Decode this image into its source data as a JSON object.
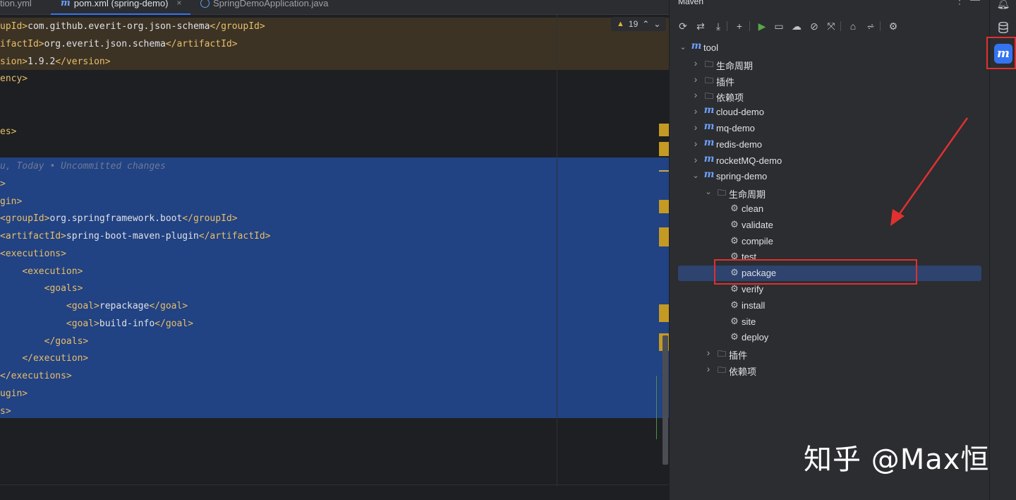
{
  "tabs": [
    {
      "label": "tion.yml",
      "icon": "yml-file-icon"
    },
    {
      "label": "pom.xml (spring-demo)",
      "icon": "maven-file-icon",
      "active": true,
      "close": "×"
    },
    {
      "label": "SpringDemoApplication.java",
      "icon": "java-class-icon"
    }
  ],
  "editor": {
    "warnings": {
      "count": "19",
      "up": "⌃",
      "down": "⌄"
    },
    "lines": [
      {
        "segs": [
          [
            "tag",
            "upId>"
          ],
          [
            "txt",
            "com.github.everit-org.json-schema"
          ],
          [
            "tag",
            "</groupId>"
          ]
        ]
      },
      {
        "segs": [
          [
            "tag",
            "ifactId>"
          ],
          [
            "txt",
            "org.everit.json.schema"
          ],
          [
            "tag",
            "</artifactId>"
          ]
        ]
      },
      {
        "segs": [
          [
            "tag",
            "sion>"
          ],
          [
            "txt",
            "1.9.2"
          ],
          [
            "tag",
            "</version>"
          ]
        ]
      },
      {
        "segs": [
          [
            "tag",
            "ency>"
          ]
        ]
      },
      {
        "segs": []
      },
      {
        "segs": []
      },
      {
        "segs": [
          [
            "tag",
            "es>"
          ]
        ]
      },
      {
        "segs": []
      },
      {
        "segs": [
          [
            "blame",
            "u, Today • Uncommitted changes"
          ]
        ]
      },
      {
        "segs": [
          [
            "tag",
            ">"
          ]
        ]
      },
      {
        "segs": [
          [
            "tag",
            "gin>"
          ]
        ]
      },
      {
        "segs": [
          [
            "tag",
            "<groupId>"
          ],
          [
            "txt",
            "org.springframework.boot"
          ],
          [
            "tag",
            "</groupId>"
          ]
        ]
      },
      {
        "segs": [
          [
            "tag",
            "<artifactId>"
          ],
          [
            "txt",
            "spring-boot-maven-plugin"
          ],
          [
            "tag",
            "</artifactId>"
          ]
        ]
      },
      {
        "segs": [
          [
            "tag",
            "<executions>"
          ]
        ]
      },
      {
        "segs": [
          [
            "txt",
            "    "
          ],
          [
            "tag",
            "<execution>"
          ]
        ]
      },
      {
        "segs": [
          [
            "txt",
            "        "
          ],
          [
            "tag",
            "<goals>"
          ]
        ]
      },
      {
        "segs": [
          [
            "txt",
            "            "
          ],
          [
            "tag",
            "<goal>"
          ],
          [
            "txt",
            "repackage"
          ],
          [
            "tag",
            "</goal>"
          ]
        ]
      },
      {
        "segs": [
          [
            "txt",
            "            "
          ],
          [
            "tag",
            "<goal>"
          ],
          [
            "txt",
            "build-info"
          ],
          [
            "tag",
            "</goal>"
          ]
        ]
      },
      {
        "segs": [
          [
            "txt",
            "        "
          ],
          [
            "tag",
            "</goals>"
          ]
        ]
      },
      {
        "segs": [
          [
            "txt",
            "    "
          ],
          [
            "tag",
            "</execution>"
          ]
        ]
      },
      {
        "segs": [
          [
            "tag",
            "</executions>"
          ]
        ]
      },
      {
        "segs": [
          [
            "tag",
            "ugin>"
          ]
        ]
      },
      {
        "segs": [
          [
            "tag",
            "s>"
          ]
        ]
      }
    ]
  },
  "maven": {
    "title": "Maven",
    "more": "⋮",
    "minimize": "—",
    "toolbar": [
      {
        "name": "reload-icon",
        "glyph": "⟳"
      },
      {
        "name": "generate-sources-icon",
        "glyph": "⇄"
      },
      {
        "name": "download-icon",
        "glyph": "⤓"
      },
      {
        "name": "add-icon",
        "glyph": "+"
      },
      {
        "name": "run-icon",
        "glyph": "▶"
      },
      {
        "name": "execute-goal-icon",
        "glyph": "▭"
      },
      {
        "name": "offline-mode-icon",
        "glyph": "☁"
      },
      {
        "name": "skip-tests-icon",
        "glyph": "⊘"
      },
      {
        "name": "collapse-icon",
        "glyph": "⤧"
      },
      {
        "name": "show-dependencies-icon",
        "glyph": "⌂"
      },
      {
        "name": "expand-all-icon",
        "glyph": "⩫"
      },
      {
        "name": "settings-icon",
        "glyph": "⚙"
      }
    ],
    "tree": [
      {
        "level": 0,
        "expanded": true,
        "icon": "m",
        "label": "tool"
      },
      {
        "level": 1,
        "expanded": false,
        "icon": "folder",
        "label": "生命周期"
      },
      {
        "level": 1,
        "expanded": false,
        "icon": "folder",
        "label": "插件"
      },
      {
        "level": 1,
        "expanded": false,
        "icon": "folder",
        "label": "依赖项"
      },
      {
        "level": 1,
        "expanded": false,
        "icon": "m",
        "label": "cloud-demo"
      },
      {
        "level": 1,
        "expanded": false,
        "icon": "m",
        "label": "mq-demo"
      },
      {
        "level": 1,
        "expanded": false,
        "icon": "m",
        "label": "redis-demo"
      },
      {
        "level": 1,
        "expanded": false,
        "icon": "m",
        "label": "rocketMQ-demo"
      },
      {
        "level": 1,
        "expanded": true,
        "icon": "m",
        "label": "spring-demo"
      },
      {
        "level": 2,
        "expanded": true,
        "icon": "folder",
        "label": "生命周期"
      },
      {
        "level": 3,
        "icon": "gear",
        "label": "clean"
      },
      {
        "level": 3,
        "icon": "gear",
        "label": "validate"
      },
      {
        "level": 3,
        "icon": "gear",
        "label": "compile"
      },
      {
        "level": 3,
        "icon": "gear",
        "label": "test"
      },
      {
        "level": 3,
        "icon": "gear",
        "label": "package",
        "selected": true
      },
      {
        "level": 3,
        "icon": "gear",
        "label": "verify"
      },
      {
        "level": 3,
        "icon": "gear",
        "label": "install"
      },
      {
        "level": 3,
        "icon": "gear",
        "label": "site"
      },
      {
        "level": 3,
        "icon": "gear",
        "label": "deploy"
      },
      {
        "level": 2,
        "expanded": false,
        "icon": "folder",
        "label": "插件"
      },
      {
        "level": 2,
        "expanded": false,
        "icon": "folder",
        "label": "依赖项"
      }
    ]
  },
  "right_strip": {
    "notifications_icon": "bell-icon",
    "database_icon": "database-icon",
    "maven_label": "m"
  },
  "watermark": "知乎 @Max恒",
  "colors": {
    "annotation": "#e03030",
    "accent": "#3574f0",
    "selection": "#214283"
  }
}
